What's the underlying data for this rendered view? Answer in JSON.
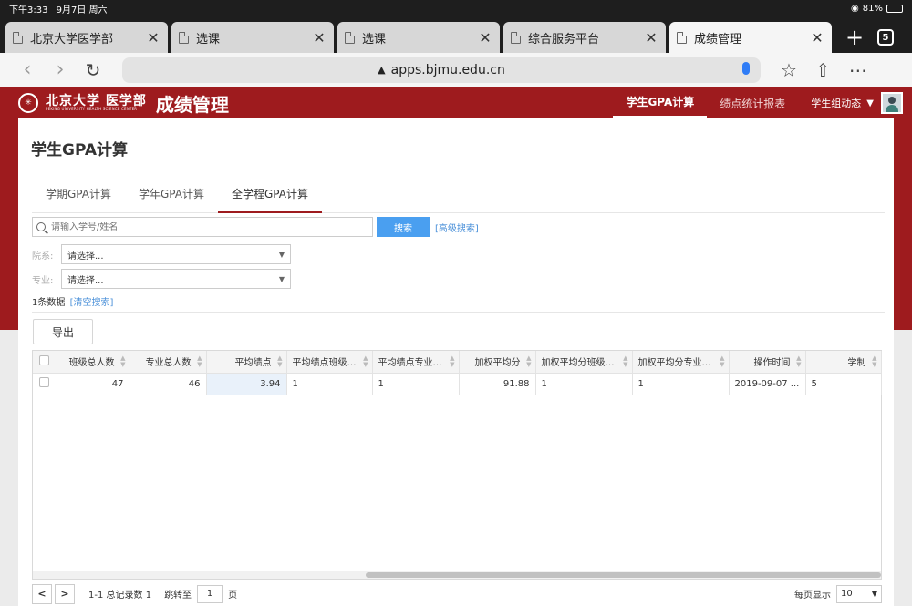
{
  "status_bar": {
    "time": "下午3:33",
    "date": "9月7日 周六",
    "battery": "81%",
    "battery_level": 0.81
  },
  "tabs": [
    {
      "label": "北京大学医学部",
      "active": false
    },
    {
      "label": "选课",
      "active": false
    },
    {
      "label": "选课",
      "active": false
    },
    {
      "label": "综合服务平台",
      "active": false
    },
    {
      "label": "成绩管理",
      "active": true
    }
  ],
  "tab_count": "5",
  "address": {
    "url": "apps.bjmu.edu.cn"
  },
  "header": {
    "logo_cn": "北京大学 医学部",
    "logo_en": "PEKING UNIVERSITY HEALTH SCIENCE CENTER",
    "app_title": "成绩管理",
    "nav": [
      {
        "label": "学生GPA计算",
        "active": true
      },
      {
        "label": "绩点统计报表",
        "active": false
      }
    ],
    "user_label": "学生组动态"
  },
  "page": {
    "title": "学生GPA计算",
    "sub_tabs": [
      {
        "label": "学期GPA计算",
        "active": false
      },
      {
        "label": "学年GPA计算",
        "active": false
      },
      {
        "label": "全学程GPA计算",
        "active": true
      }
    ],
    "search": {
      "placeholder": "请输入学号/姓名",
      "button": "搜索",
      "advanced": "[高级搜索]"
    },
    "filters": [
      {
        "label": "院系:",
        "value": "请选择..."
      },
      {
        "label": "专业:",
        "value": "请选择..."
      }
    ],
    "result_count": "1条数据",
    "clear_search": "[清空搜索]",
    "export_label": "导出"
  },
  "grid": {
    "columns": [
      "班级总人数",
      "专业总人数",
      "平均绩点",
      "平均绩点班级排名",
      "平均绩点专业排名",
      "加权平均分",
      "加权平均分班级排名",
      "加权平均分专业排名",
      "操作时间",
      "学制"
    ],
    "rows": [
      [
        "47",
        "46",
        "3.94",
        "1",
        "1",
        "91.88",
        "1",
        "1",
        "2019-09-07 ...",
        "5"
      ]
    ]
  },
  "pager": {
    "prev": "<",
    "next": ">",
    "info": "1-1 总记录数 1",
    "jump_label": "跳转至",
    "page": "1",
    "page_suffix": "页",
    "per_page_label": "每页显示",
    "per_page_value": "10"
  },
  "colors": {
    "brand_red": "#9e1b1e",
    "search_blue": "#4a9ff0",
    "link_blue": "#4a90d9"
  }
}
